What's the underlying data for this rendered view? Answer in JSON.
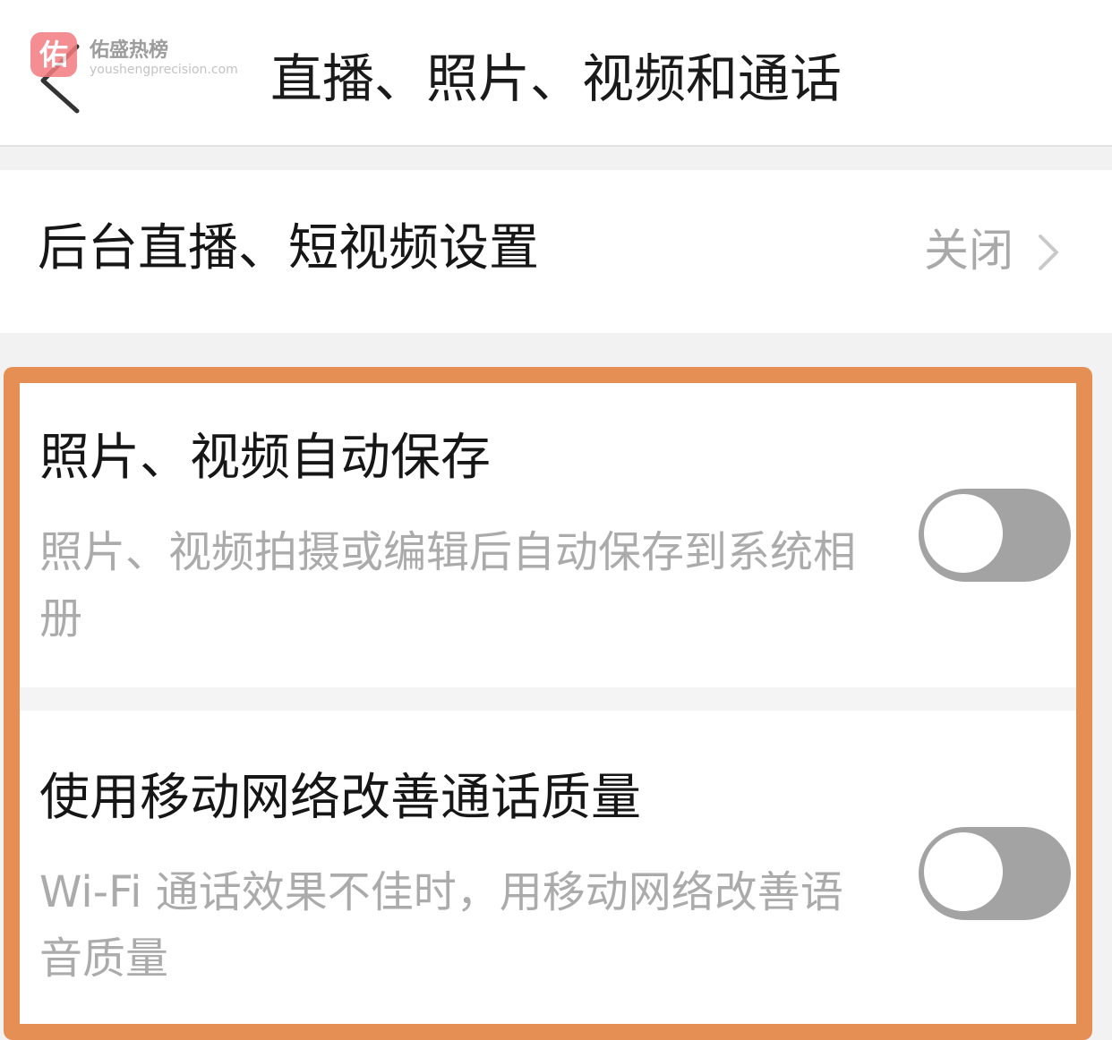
{
  "header": {
    "title": "直播、照片、视频和通话",
    "watermark_logo": "佑",
    "watermark_name": "佑盛热榜",
    "watermark_url": "youshengprecision.com"
  },
  "background_live": {
    "label": "后台直播、短视频设置",
    "value": "关闭"
  },
  "settings": [
    {
      "title": "照片、视频自动保存",
      "description": "照片、视频拍摄或编辑后自动保存到系统相册",
      "enabled": false
    },
    {
      "title": "使用移动网络改善通话质量",
      "description": "Wi-Fi 通话效果不佳时，用移动网络改善语音质量",
      "enabled": false
    }
  ],
  "colors": {
    "highlight_border": "#e58f55",
    "toggle_off": "#a3a3a3",
    "secondary_text": "#ababab"
  },
  "icons": {
    "back": "chevron-left-icon",
    "row_arrow": "chevron-right-icon"
  }
}
